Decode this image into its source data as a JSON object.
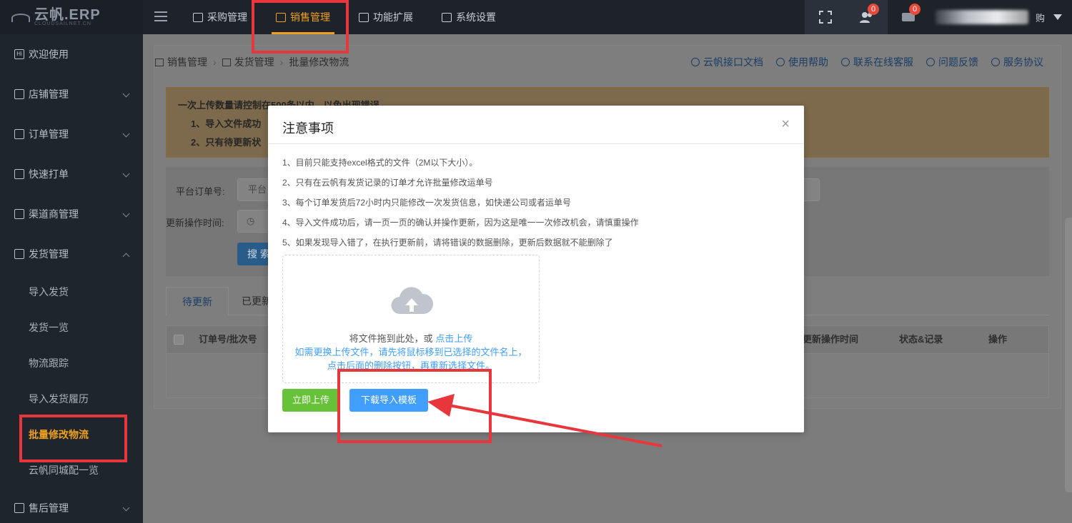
{
  "header": {
    "logo_text": "云帆.ERP",
    "logo_sub": "CLOUDSAILNET.CN",
    "nav": [
      {
        "label": "采购管理",
        "icon": "purchase-icon"
      },
      {
        "label": "销售管理",
        "icon": "sales-icon",
        "active": true
      },
      {
        "label": "功能扩展",
        "icon": "extension-icon"
      },
      {
        "label": "系统设置",
        "icon": "settings-icon"
      }
    ],
    "badges": {
      "notice": "0",
      "message": "0"
    },
    "user_suffix": "购"
  },
  "sidebar": {
    "items": [
      {
        "label": "欢迎使用"
      },
      {
        "label": "店铺管理"
      },
      {
        "label": "订单管理"
      },
      {
        "label": "快速打单"
      },
      {
        "label": "渠道商管理"
      },
      {
        "label": "发货管理"
      }
    ],
    "sub_items": [
      {
        "label": "导入发货"
      },
      {
        "label": "发货一览"
      },
      {
        "label": "物流跟踪"
      },
      {
        "label": "导入发货履历"
      },
      {
        "label": "批量修改物流",
        "active": true
      },
      {
        "label": "云帆同城配一览"
      }
    ],
    "after": {
      "label": "售后管理"
    }
  },
  "breadcrumb": [
    "销售管理",
    "发货管理",
    "批量修改物流"
  ],
  "toplinks": [
    "云帆接口文档",
    "使用帮助",
    "联系在线客服",
    "问题反馈",
    "服务协议"
  ],
  "notice": {
    "line1": "一次上传数量请控制在500条以内，以免出现错误",
    "line2": "1、导入文件成功",
    "line3": "2、只有待更新状"
  },
  "filters": {
    "order_label": "平台订单号:",
    "order_placeholder": "平台",
    "time_label": "更新操作时间:",
    "search_btn": "搜 索"
  },
  "tabs": [
    "待更新",
    "已更新"
  ],
  "table": {
    "columns": [
      "订单号/批次号",
      "更新操作时间",
      "状态&记录",
      "操作"
    ]
  },
  "modal": {
    "title": "注意事项",
    "close": "×",
    "rules": [
      "1、目前只能支持excel格式的文件（2M以下大小）。",
      "2、只有在云帆有发货记录的订单才允许批量修改运单号",
      "3、每个订单发货后72小时内只能修改一次发货信息，如快递公司或者运单号",
      "4、导入文件成功后，请一页一页的确认并操作更新，因为这是唯一一次修改机会，请慎重操作",
      "5、如果发现导入错了，在执行更新前，请将错误的数据删除，更新后数据就不能删除了"
    ],
    "drop_text": "将文件拖到此处，或",
    "drop_link": "点击上传",
    "hint1": "如需更换上传文件，请先将鼠标移到已选择的文件名上，",
    "hint2": "点击后面的删除按钮，再重新选择文件。",
    "upload_btn": "立即上传",
    "template_btn": "下载导入模板"
  },
  "colors": {
    "accent": "#f0a020",
    "primary": "#409eff",
    "success": "#67c23a",
    "annotation": "#e8373c"
  }
}
